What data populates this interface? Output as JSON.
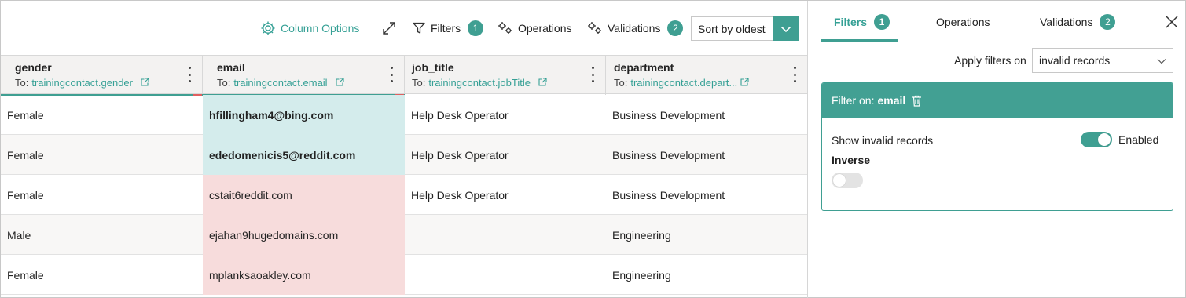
{
  "colors": {
    "accent": "#3f9f92",
    "accent_text": "#35a095",
    "valid_cell": "#d4ecec",
    "invalid_cell": "#f7dcdc",
    "invalid_marker": "#e06060"
  },
  "toolbar": {
    "column_options": "Column Options",
    "filters": "Filters",
    "filters_count": "1",
    "operations": "Operations",
    "validations": "Validations",
    "validations_count": "2",
    "sort_value": "Sort by oldest",
    "icons": [
      "gear-icon",
      "expand-icon",
      "filter-icon",
      "operations-icon",
      "validations-icon",
      "chevron-down-icon"
    ]
  },
  "grid": {
    "to_prefix": "To:",
    "columns": [
      {
        "name": "gender",
        "mapping": "trainingcontact.gender"
      },
      {
        "name": "email",
        "mapping": "trainingcontact.email"
      },
      {
        "name": "job_title",
        "mapping": "trainingcontact.jobTitle"
      },
      {
        "name": "department",
        "mapping": "trainingcontact.depart..."
      }
    ],
    "rows": [
      {
        "gender": "Female",
        "email": "hfillingham4@bing.com",
        "job_title": "Help Desk Operator",
        "department": "Business Development"
      },
      {
        "gender": "Female",
        "email": "ededomenicis5@reddit.com",
        "job_title": "Help Desk Operator",
        "department": "Business Development"
      },
      {
        "gender": "Female",
        "email": "cstait6reddit.com",
        "job_title": "Help Desk Operator",
        "department": "Business Development"
      },
      {
        "gender": "Male",
        "email": "ejahan9hugedomains.com",
        "job_title": "",
        "department": "Engineering"
      },
      {
        "gender": "Female",
        "email": "mplanksaoakley.com",
        "job_title": "",
        "department": "Engineering"
      }
    ]
  },
  "panel": {
    "tabs": [
      {
        "label": "Filters",
        "count": "1"
      },
      {
        "label": "Operations",
        "count": ""
      },
      {
        "label": "Validations",
        "count": "2"
      }
    ],
    "apply_label": "Apply filters on",
    "apply_value": "invalid records",
    "filter_card": {
      "title_prefix": "Filter on:",
      "field": "email",
      "show_invalid_label": "Show invalid records",
      "show_invalid_state": "Enabled",
      "inverse_label": "Inverse"
    }
  }
}
